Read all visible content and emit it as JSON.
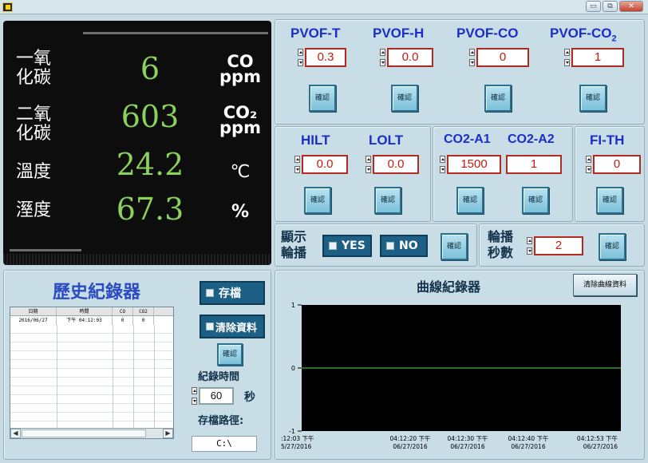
{
  "window": {
    "buttons": {
      "minimize": "▭",
      "restore": "⧉",
      "close": "✕"
    },
    "icon": "labview-icon"
  },
  "display": {
    "rows": [
      {
        "label_line1": "一氧",
        "label_line2": "化碳",
        "value": "6",
        "unit_line1": "CO",
        "unit_line2": "ppm"
      },
      {
        "label_line1": "二氧",
        "label_line2": "化碳",
        "value": "603",
        "unit_line1": "CO₂",
        "unit_line2": "ppm"
      },
      {
        "label_line1": "溫度",
        "label_line2": "",
        "value": "24.2",
        "unit_line1": "℃",
        "unit_line2": ""
      },
      {
        "label_line1": "溼度",
        "label_line2": "",
        "value": "67.3",
        "unit_line1": "%",
        "unit_line2": ""
      }
    ],
    "value_color": "#8ad25a"
  },
  "pvof": {
    "items": [
      {
        "label": "PVOF-T",
        "value": "0.3",
        "confirm": "確認"
      },
      {
        "label": "PVOF-H",
        "value": "0.0",
        "confirm": "確認"
      },
      {
        "label": "PVOF-CO",
        "value": "0",
        "confirm": "確認"
      },
      {
        "label": "PVOF-CO",
        "label_sub": "2",
        "value": "1",
        "confirm": "確認"
      }
    ]
  },
  "limits": {
    "hilt": {
      "label": "HILT",
      "value": "0.0",
      "confirm": "確認"
    },
    "lolt": {
      "label": "LOLT",
      "value": "0.0",
      "confirm": "確認"
    },
    "co2a1": {
      "label": "CO2-A1",
      "value": "1500",
      "confirm": "確認"
    },
    "co2a2": {
      "label": "CO2-A2",
      "value": "1",
      "confirm": "確認"
    },
    "fith": {
      "label": "FI-TH",
      "value": "0",
      "confirm": "確認"
    }
  },
  "rotation": {
    "label_line1": "顯示",
    "label_line2": "輪播",
    "yes_label": "YES",
    "no_label": "NO",
    "confirm": "確認",
    "seconds_label_line1": "輪播",
    "seconds_label_line2": "秒數",
    "seconds_value": "2",
    "seconds_confirm": "確認"
  },
  "history": {
    "title": "歷史紀錄器",
    "columns": [
      "日期",
      "時間",
      "CO",
      "CO2",
      ""
    ],
    "rows": [
      [
        "2016/06/27",
        "下午 04:12:03",
        "0",
        "0",
        ""
      ]
    ],
    "save_button": "存檔",
    "clear_button": "清除資料",
    "confirm": "確認",
    "record_time_label": "紀錄時間",
    "record_time_value": "60",
    "record_time_unit": "秒",
    "save_path_label": "存檔路徑:",
    "save_path_value": "C:\\"
  },
  "chart": {
    "title": "曲線紀錄器",
    "clear_button": "清除曲線資料",
    "y_ticks": [
      "1",
      "0",
      "-1"
    ],
    "x_ticks": [
      {
        "time": ":12:03 下午",
        "date": "5/27/2016"
      },
      {
        "time": "04:12:20 下午",
        "date": "06/27/2016"
      },
      {
        "time": "04:12:30 下午",
        "date": "06/27/2016"
      },
      {
        "time": "04:12:40 下午",
        "date": "06/27/2016"
      },
      {
        "time": "04:12:53 下午",
        "date": "06/27/2016"
      }
    ],
    "line_color": "#3e8f3a",
    "background": "#000000",
    "trace_value": 0
  }
}
